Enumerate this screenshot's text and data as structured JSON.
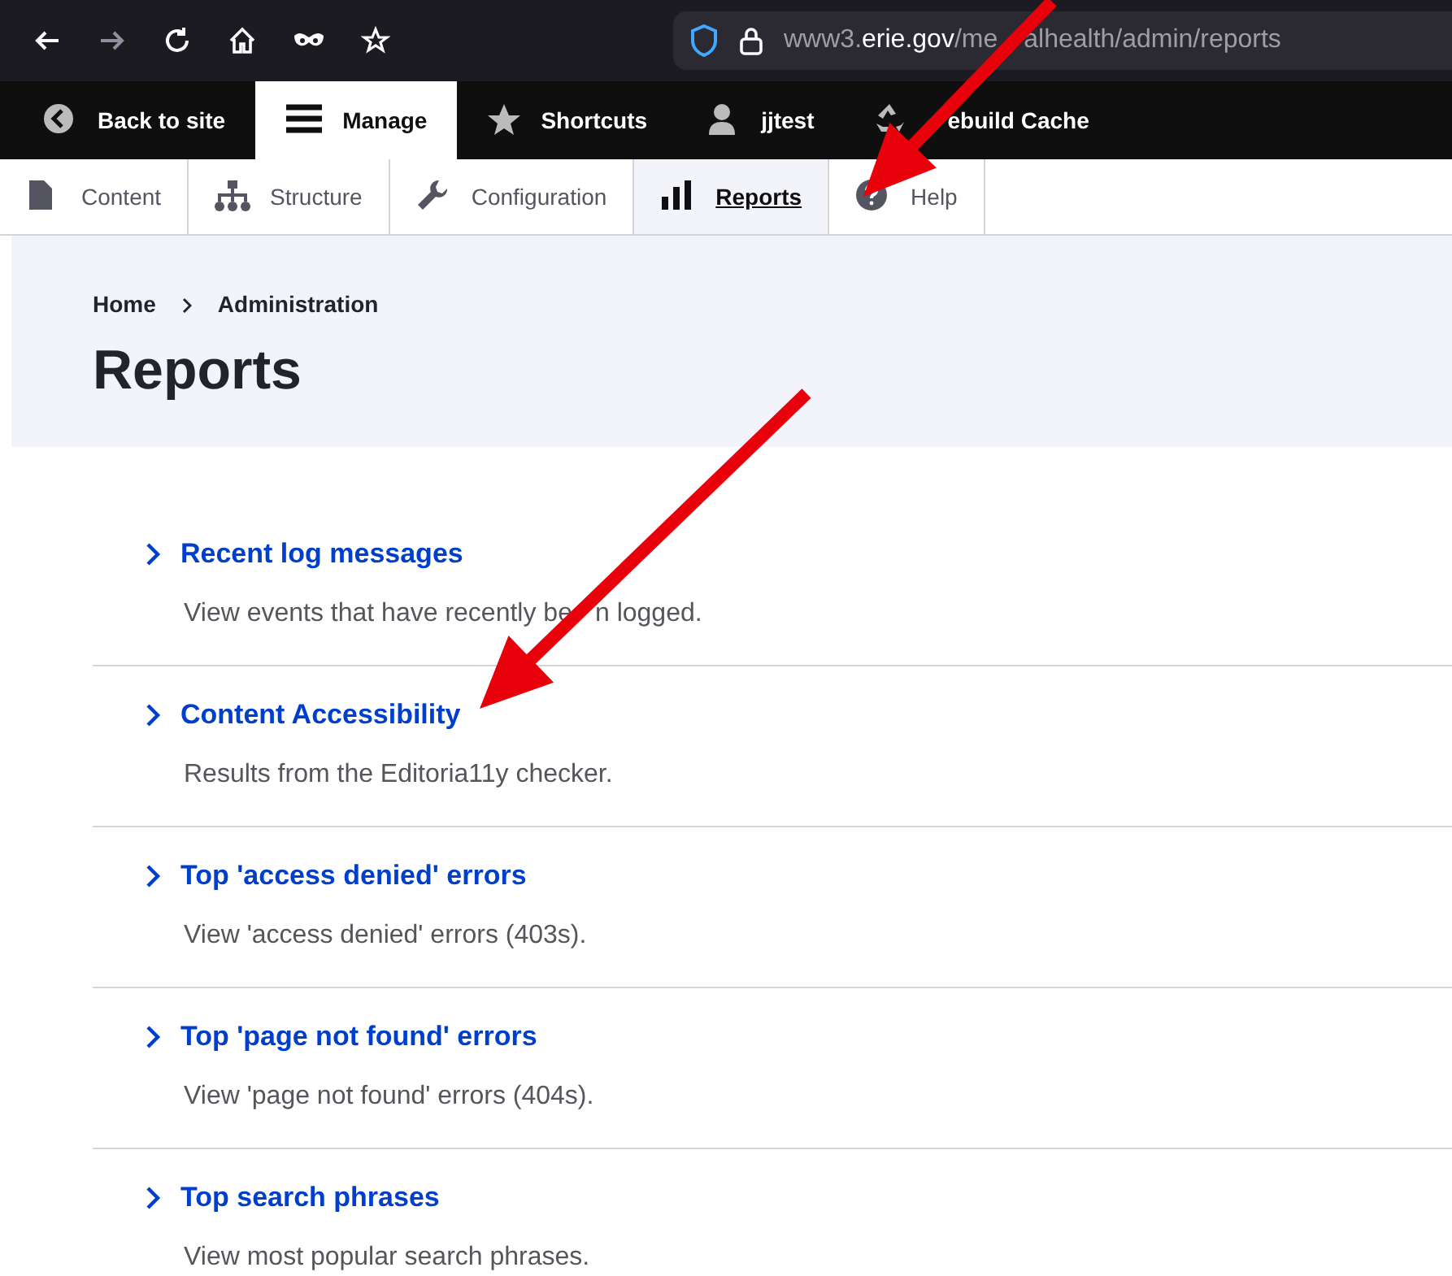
{
  "browser": {
    "url_host_prefix": "www3.",
    "url_host": "erie.gov",
    "url_path_parts": [
      "/me",
      "alhealth/admin/reports"
    ]
  },
  "toolbar": {
    "items": [
      {
        "kind": "back",
        "label": "Back to site",
        "selected": false
      },
      {
        "kind": "manage",
        "label": "Manage",
        "selected": true
      },
      {
        "kind": "star",
        "label": "Shortcuts",
        "selected": false
      },
      {
        "kind": "user",
        "label": "jjtest",
        "selected": false
      },
      {
        "kind": "recycle",
        "label": "ebuild Cache",
        "selected": false,
        "start_covered": true
      }
    ]
  },
  "admin_menu": {
    "items": [
      {
        "kind": "file",
        "label": "Content",
        "selected": false
      },
      {
        "kind": "tree",
        "label": "Structure",
        "selected": false
      },
      {
        "kind": "wrench",
        "label": "Configuration",
        "selected": false
      },
      {
        "kind": "bars",
        "label": "Reports",
        "selected": true
      },
      {
        "kind": "help",
        "label": "Help",
        "selected": false
      }
    ]
  },
  "breadcrumb": [
    "Home",
    "Administration"
  ],
  "page_title": "Reports",
  "reports": [
    {
      "title": "Recent log messages",
      "description": [
        "View events that have recently be",
        "n logged."
      ]
    },
    {
      "title": "Content Accessibility",
      "description": [
        "Results from the Editoria11y checker."
      ]
    },
    {
      "title": "Top 'access denied' errors",
      "description": [
        "View 'access denied' errors (403s)."
      ]
    },
    {
      "title": "Top 'page not found' errors",
      "description": [
        "View 'page not found' errors (404s)."
      ]
    },
    {
      "title": "Top search phrases",
      "description": [
        "View most popular search phrases."
      ]
    }
  ]
}
